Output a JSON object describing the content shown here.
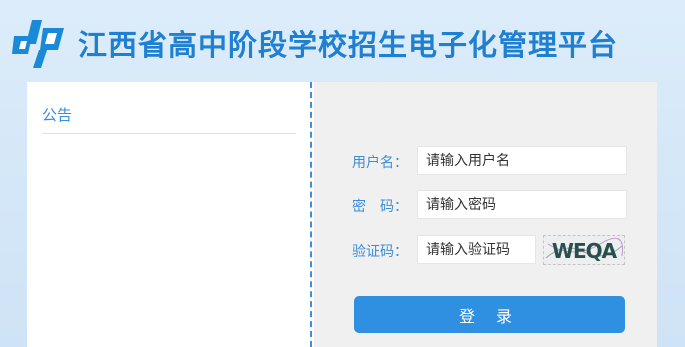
{
  "header": {
    "logo_icon": "cp-logo-icon",
    "title": "江西省高中阶段学校招生电子化管理平台"
  },
  "notice": {
    "title": "公告"
  },
  "login": {
    "username_label": "用户名：",
    "username_placeholder": "请输入用户名",
    "password_label": "密　码：",
    "password_placeholder": "请输入密码",
    "captcha_label": "验证码：",
    "captcha_placeholder": "请输入验证码",
    "captcha_text": "WEQA",
    "submit_label": "登 录"
  },
  "colors": {
    "accent": "#2f8fe0",
    "title": "#1f7fd0",
    "label": "#3a8dd8"
  }
}
